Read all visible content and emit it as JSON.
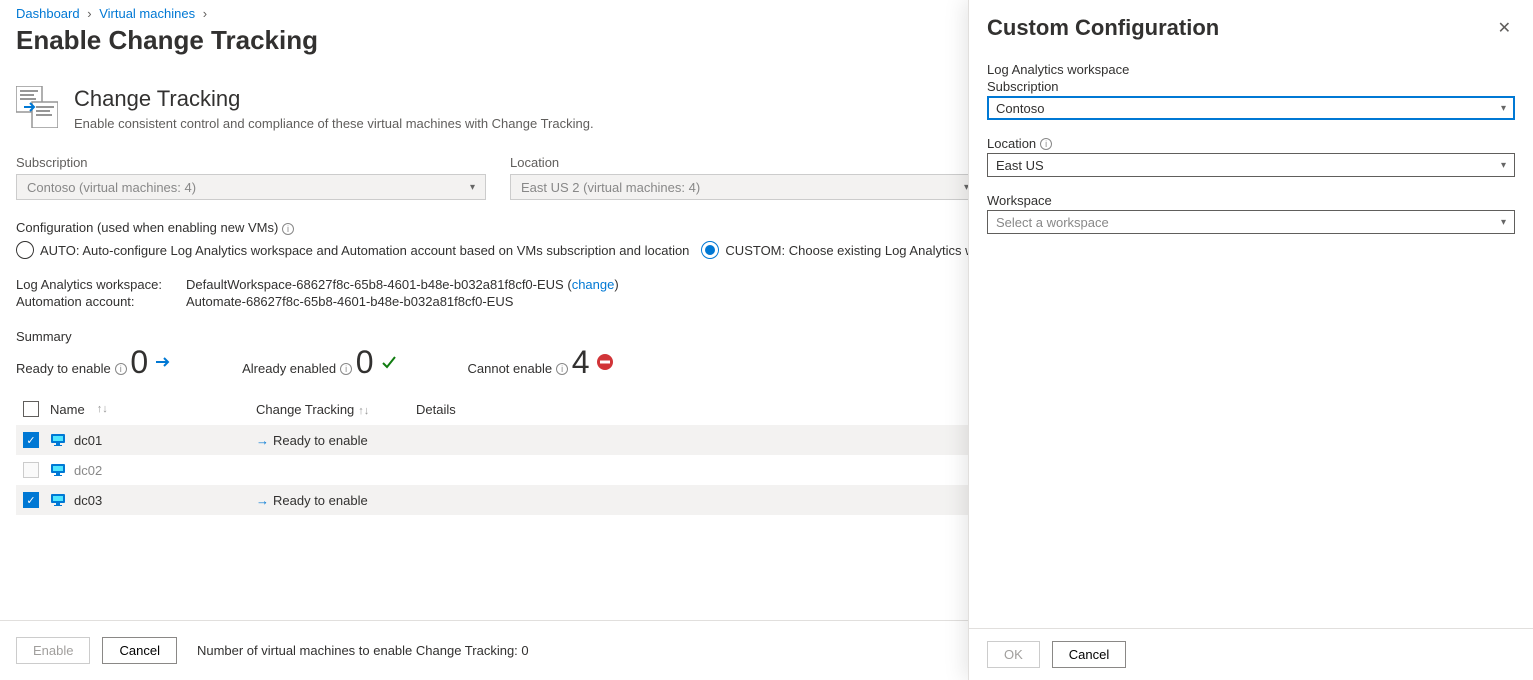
{
  "breadcrumb": {
    "items": [
      "Dashboard",
      "Virtual machines"
    ]
  },
  "page_title": "Enable Change Tracking",
  "feature": {
    "title": "Change Tracking",
    "desc": "Enable consistent control and compliance of these virtual machines with Change Tracking."
  },
  "filters": {
    "subscription_label": "Subscription",
    "subscription_value": "Contoso (virtual machines: 4)",
    "location_label": "Location",
    "location_value": "East US 2 (virtual machines: 4)"
  },
  "configuration": {
    "label": "Configuration (used when enabling new VMs)",
    "auto_label": "AUTO: Auto-configure Log Analytics workspace and Automation account based on VMs subscription and location",
    "custom_label": "CUSTOM: Choose existing Log Analytics workspace and Automation account"
  },
  "workspace_row": {
    "key": "Log Analytics workspace:",
    "val": "DefaultWorkspace-68627f8c-65b8-4601-b48e-b032a81f8cf0-EUS",
    "change": "change"
  },
  "automation_row": {
    "key": "Automation account:",
    "val": "Automate-68627f8c-65b8-4601-b48e-b032a81f8cf0-EUS"
  },
  "summary": {
    "title": "Summary",
    "ready_label": "Ready to enable",
    "ready_value": "0",
    "already_label": "Already enabled",
    "already_value": "0",
    "cannot_label": "Cannot enable",
    "cannot_value": "4"
  },
  "table": {
    "col_name": "Name",
    "col_ct": "Change Tracking",
    "col_details": "Details",
    "rows": [
      {
        "name": "dc01",
        "checked": true,
        "status": "Ready to enable",
        "dim": false
      },
      {
        "name": "dc02",
        "checked": false,
        "status": "",
        "dim": true
      },
      {
        "name": "dc03",
        "checked": true,
        "status": "Ready to enable",
        "dim": false
      }
    ]
  },
  "footer": {
    "enable": "Enable",
    "cancel": "Cancel",
    "text": "Number of virtual machines to enable Change Tracking: 0"
  },
  "panel": {
    "title": "Custom Configuration",
    "law_label": "Log Analytics workspace",
    "subscription_label": "Subscription",
    "subscription_value": "Contoso",
    "location_label": "Location",
    "location_value": "East US",
    "workspace_label": "Workspace",
    "workspace_value": "Select a workspace",
    "ok": "OK",
    "cancel": "Cancel"
  }
}
